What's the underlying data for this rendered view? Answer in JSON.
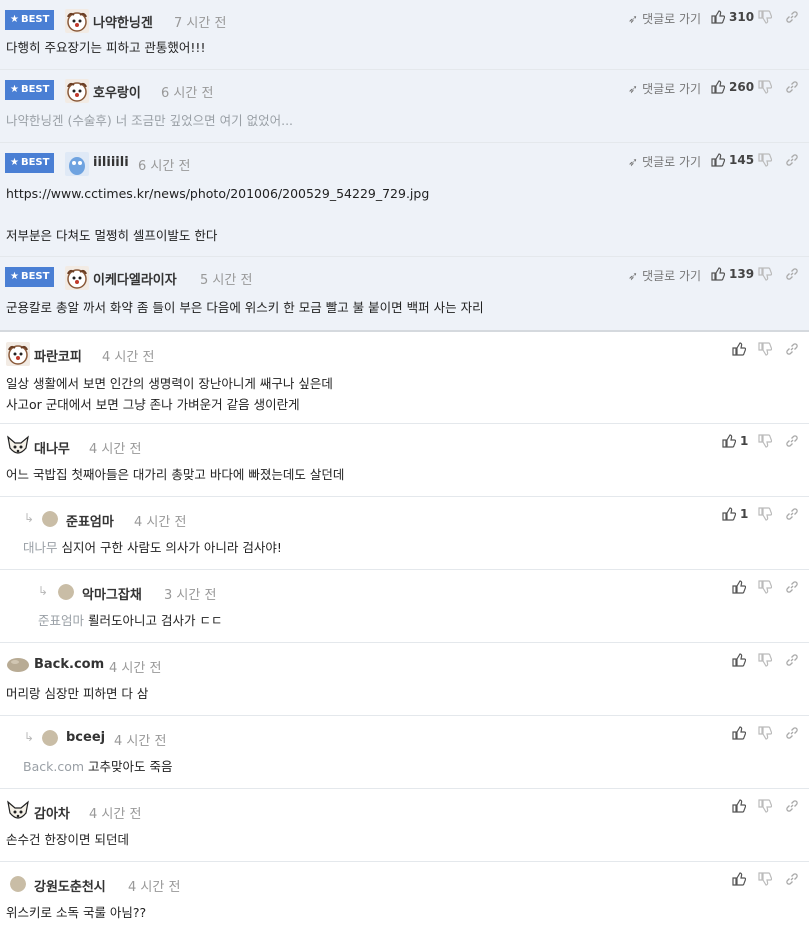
{
  "ui": {
    "best_label": "BEST",
    "reply_label": "댓글로 가기"
  },
  "best_comments": [
    {
      "nick": "나약한닝겐",
      "time": "7 시간 전",
      "likes": "310",
      "avatar": "dog",
      "body_lines": [
        "다행히 주요장기는 피하고 관통했어!!!"
      ]
    },
    {
      "nick": "호우랑이",
      "time": "6 시간 전",
      "likes": "260",
      "avatar": "dog",
      "mention": "나약한닝겐 (수술후) 너 조금만 깊었으면 여기 없었어...",
      "body_lines": []
    },
    {
      "nick": "iiliiili",
      "time": "6 시간 전",
      "likes": "145",
      "avatar": "blue",
      "body_lines": [
        "https://www.cctimes.kr/news/photo/201006/200529_54229_729.jpg",
        "",
        "저부분은 다쳐도 멀쩡히 셀프이발도 한다"
      ]
    },
    {
      "nick": "이케다엘라이자",
      "time": "5 시간 전",
      "likes": "139",
      "avatar": "dog",
      "body_lines": [
        "군용칼로 총알 까서 화약 좀 들이 부은 다음에 위스키 한 모금 빨고 불 붙이면 백퍼 사는 자리"
      ]
    }
  ],
  "comments": [
    {
      "nick": "파란코피",
      "time": "4 시간 전",
      "likes": "",
      "avatar": "dog",
      "body_lines": [
        "일상 생활에서 보면 인간의 생명력이 장난아니게 쌔구나 싶은데",
        "사고or 군대에서 보면 그냥 존나 가벼운거 같음 생이란게"
      ]
    },
    {
      "nick": "대나무",
      "time": "4 시간 전",
      "likes": "1",
      "avatar": "fox",
      "body_lines": [
        "어느 국밥집 첫째아들은 대가리 총맞고 바다에 빠졌는데도 살던데"
      ]
    },
    {
      "nick": "준표엄마",
      "time": "4 시간 전",
      "likes": "1",
      "avatar": "blob",
      "mention": "대나무",
      "body_lines": [
        "심지어 구한 사람도 의사가 아니라 검사야!"
      ]
    },
    {
      "nick": "악마그잡채",
      "time": "3 시간 전",
      "likes": "",
      "avatar": "blob",
      "mention": "준표엄마",
      "body_lines": [
        "뢸러도아니고 검사가 ㄷㄷ"
      ]
    },
    {
      "nick": "Back.com",
      "time": "4 시간 전",
      "likes": "",
      "avatar": "rock",
      "body_lines": [
        "머리랑 심장만 피하면 다 삼"
      ]
    },
    {
      "nick": "bceej",
      "time": "4 시간 전",
      "likes": "",
      "avatar": "blob",
      "mention": "Back.com",
      "body_lines": [
        "고추맞아도 죽음"
      ]
    },
    {
      "nick": "감아차",
      "time": "4 시간 전",
      "likes": "",
      "avatar": "fox",
      "body_lines": [
        "손수건 한장이면 되던데"
      ]
    },
    {
      "nick": "강원도춘천시",
      "time": "4 시간 전",
      "likes": "",
      "avatar": "blob",
      "body_lines": [
        "위스키로 소독 국룰 아님??"
      ]
    }
  ],
  "colors": {
    "best_bg": "#eef2f8",
    "badge": "#4a7fd4",
    "muted": "#999999"
  }
}
